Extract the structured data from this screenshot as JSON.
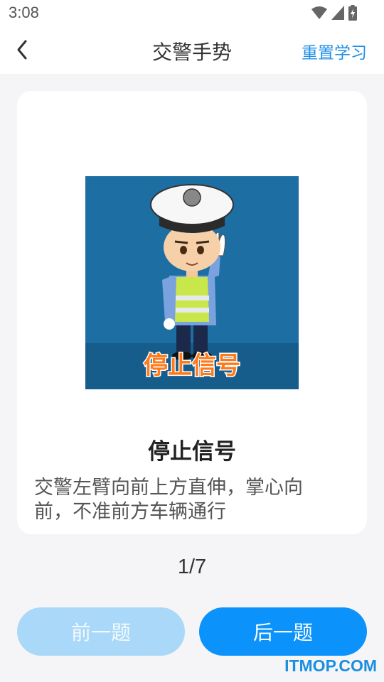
{
  "status_bar": {
    "time": "3:08",
    "icons": [
      "wifi-icon",
      "signal-icon",
      "battery-icon"
    ]
  },
  "header": {
    "back_icon": "chevron-left-icon",
    "title": "交警手势",
    "reset_label": "重置学习"
  },
  "card": {
    "image_caption": "停止信号",
    "sign_name": "停止信号",
    "description": "交警左臂向前上方直伸，掌心向前，不准前方车辆通行"
  },
  "counter": "1/7",
  "buttons": {
    "prev": "前一题",
    "next": "后一题"
  },
  "watermark": "ITMOP.COM",
  "colors": {
    "accent": "#0c93fb",
    "accent_light": "#a9d8f8",
    "background": "#f5f5f7",
    "illustration_bg": "#1d6ea3"
  }
}
